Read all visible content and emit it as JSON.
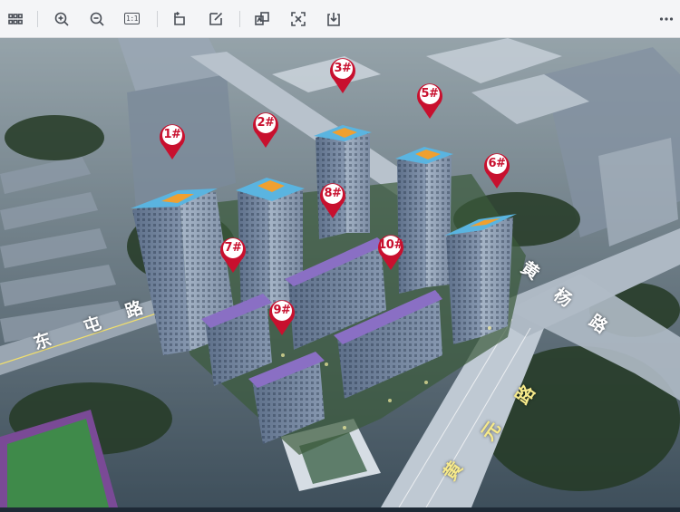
{
  "toolbar": {
    "items": [
      {
        "name": "grid-view-button",
        "icon": "grid-icon"
      },
      {
        "name": "zoom-in-button",
        "icon": "zoom-in-icon"
      },
      {
        "name": "zoom-out-button",
        "icon": "zoom-out-icon"
      },
      {
        "name": "actual-size-button",
        "icon": "ratio-icon",
        "label": "1:1"
      },
      {
        "name": "rotate-button",
        "icon": "rotate-icon"
      },
      {
        "name": "edit-button",
        "icon": "edit-icon"
      },
      {
        "name": "translate-button",
        "icon": "translate-icon"
      },
      {
        "name": "ocr-button",
        "icon": "ocr-icon"
      },
      {
        "name": "download-button",
        "icon": "download-icon"
      },
      {
        "name": "more-button",
        "icon": "more-icon"
      }
    ]
  },
  "buildings": [
    {
      "label": "1#"
    },
    {
      "label": "2#"
    },
    {
      "label": "3#"
    },
    {
      "label": "5#"
    },
    {
      "label": "6#"
    },
    {
      "label": "7#"
    },
    {
      "label": "8#"
    },
    {
      "label": "9#"
    },
    {
      "label": "10#"
    }
  ],
  "roads": {
    "dongtun": [
      "东",
      "屯",
      "路"
    ],
    "huangyang": [
      "黄",
      "杨",
      "路"
    ],
    "huangyuan": [
      "黄",
      "元",
      "路"
    ]
  },
  "colors": {
    "marker_red": "#c8102e",
    "roof_orange": "#f0a030",
    "roof_blue": "#5ab4e0",
    "roof_purple": "#8a6fc4",
    "facade": "#7f93ab"
  }
}
